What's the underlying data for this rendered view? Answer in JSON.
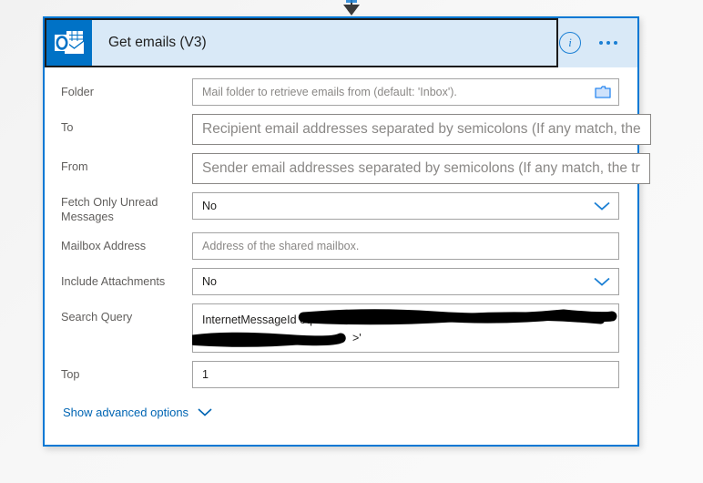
{
  "connector": {
    "icon": "arrow-down-icon"
  },
  "header": {
    "app_icon": "outlook-icon",
    "title": "Get emails (V3)",
    "info_icon": "info-icon",
    "info_glyph": "i",
    "more_icon": "ellipsis-menu-icon",
    "accent_color": "#0078d4",
    "header_background": "#d9e9f7",
    "icon_background": "#0072c6"
  },
  "fields": [
    {
      "name": "folder",
      "label": "Folder",
      "placeholder": "Mail folder to retrieve emails from (default: 'Inbox').",
      "value": "",
      "control": "text",
      "trailing_icon": "folder-picker-icon"
    },
    {
      "name": "to",
      "label": "To",
      "placeholder": "Recipient email addresses separated by semicolons (If any match, the",
      "value": "",
      "control": "text-large",
      "trailing_icon": ""
    },
    {
      "name": "from",
      "label": "From",
      "placeholder": "Sender email addresses separated by semicolons (If any match, the tr",
      "value": "",
      "control": "text-large",
      "trailing_icon": ""
    },
    {
      "name": "fetch-only-unread-messages",
      "label": "Fetch Only Unread Messages",
      "placeholder": "",
      "value": "No",
      "control": "dropdown",
      "trailing_icon": "chevron-down-icon"
    },
    {
      "name": "mailbox-address",
      "label": "Mailbox Address",
      "placeholder": "Address of the shared mailbox.",
      "value": "",
      "control": "text",
      "trailing_icon": ""
    },
    {
      "name": "include-attachments",
      "label": "Include Attachments",
      "placeholder": "",
      "value": "No",
      "control": "dropdown",
      "trailing_icon": "chevron-down-icon"
    },
    {
      "name": "search-query",
      "label": "Search Query",
      "placeholder": "",
      "value": "InternetMessageId eq '<",
      "value_suffix": ">'",
      "control": "textarea-redacted",
      "trailing_icon": ""
    },
    {
      "name": "top",
      "label": "Top",
      "placeholder": "",
      "value": "1",
      "control": "text",
      "trailing_icon": ""
    }
  ],
  "advanced_options": {
    "label": "Show advanced options",
    "icon": "chevron-down-icon",
    "link_color": "#0065b3"
  }
}
